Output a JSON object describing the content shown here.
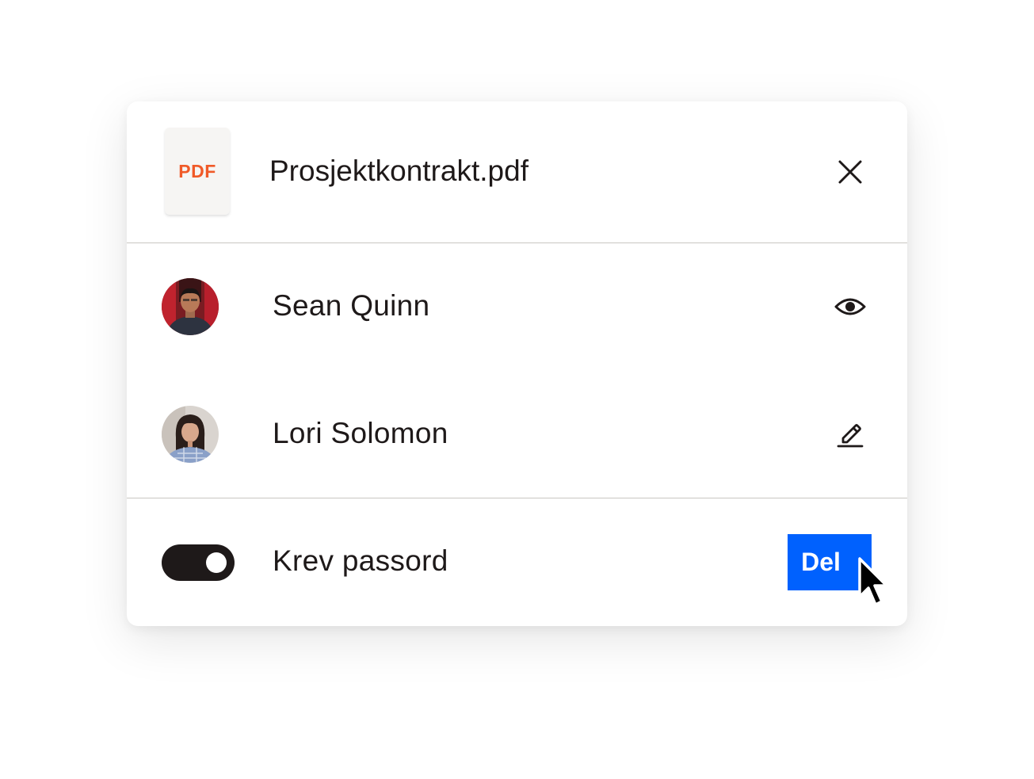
{
  "file": {
    "type_label": "PDF",
    "name": "Prosjektkontrakt.pdf",
    "close_icon": "close-icon"
  },
  "members": [
    {
      "name": "Sean Quinn",
      "permission_icon": "eye-icon",
      "permission": "view"
    },
    {
      "name": "Lori Solomon",
      "permission_icon": "pencil-icon",
      "permission": "edit"
    }
  ],
  "password": {
    "label": "Krev passord",
    "enabled": true
  },
  "share_button": {
    "label": "Del"
  },
  "colors": {
    "accent": "#0061fe",
    "pdf_label": "#f05a28",
    "text": "#1e1919",
    "toggle_on": "#1e1919"
  }
}
